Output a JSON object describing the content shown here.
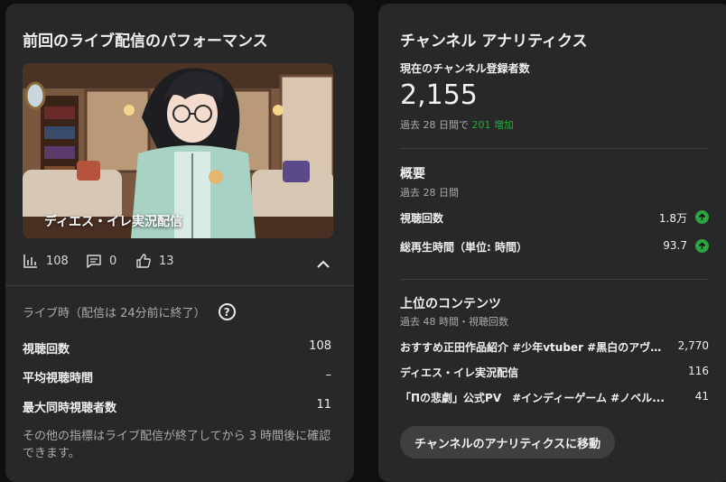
{
  "left": {
    "title": "前回のライブ配信のパフォーマンス",
    "video_title": "ディエス・イレ実況配信",
    "stats": {
      "views": "108",
      "comments": "0",
      "likes": "13"
    },
    "live_label": "ライブ時（配信は 24分前に終了）",
    "metrics": [
      {
        "label": "視聴回数",
        "value": "108"
      },
      {
        "label": "平均視聴時間",
        "value": "–"
      },
      {
        "label": "最大同時視聴者数",
        "value": "11"
      }
    ],
    "note": "その他の指標はライブ配信が終了してから 3 時間後に確認できます。"
  },
  "right": {
    "title": "チャンネル アナリティクス",
    "subs_label": "現在のチャンネル登録者数",
    "subs_count": "2,155",
    "subs_change_prefix": "過去 28 日間で",
    "subs_change_value": "201 増加",
    "overview_title": "概要",
    "overview_period": "過去 28 日間",
    "overview_rows": [
      {
        "label": "視聴回数",
        "value": "1.8万"
      },
      {
        "label": "総再生時間（単位: 時間）",
        "value": "93.7"
      }
    ],
    "top_title": "上位のコンテンツ",
    "top_period": "過去 48 時間・視聴回数",
    "top_rows": [
      {
        "label": "おすすめ正田作品紹介 #少年vtuber #黒白のアヴェ...",
        "value": "2,770"
      },
      {
        "label": "ディエス・イレ実況配信",
        "value": "116"
      },
      {
        "label": "「Πの悲劇」公式PV　#インディーゲーム #ノベル...",
        "value": "41"
      }
    ],
    "button_label": "チャンネルのアナリティクスに移動"
  },
  "colors": {
    "card_bg": "#282828",
    "page_bg": "#0f0f0f",
    "accent_green": "#2ba640"
  },
  "icons": [
    "bar-chart-icon",
    "comment-icon",
    "thumbs-up-icon",
    "chevron-up-icon",
    "help-icon",
    "arrow-up-icon"
  ]
}
